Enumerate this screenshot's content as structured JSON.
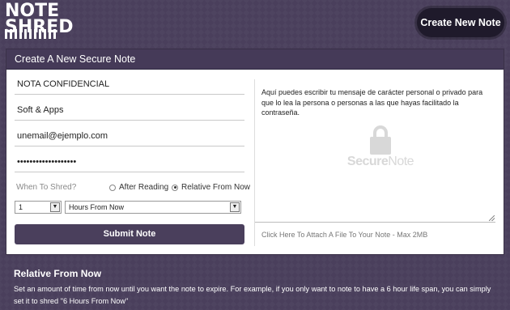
{
  "header": {
    "logo_line1": "NOTE",
    "logo_line2": "SHRED",
    "create_button": "Create New Note"
  },
  "panel": {
    "title": "Create A New Secure Note",
    "fields": {
      "title_value": "NOTA CONFIDENCIAL",
      "name_value": "Soft & Apps",
      "email_value": "unemail@ejemplo.com",
      "password_value": "•••••••••••••••••••"
    },
    "shred": {
      "label": "When To Shred?",
      "option_after": "After Reading",
      "option_relative": "Relative From Now",
      "selected": "Relative From Now",
      "amount": "1",
      "unit": "Hours From Now"
    },
    "submit": "Submit Note",
    "note_text": "Aquí puedes escribir tu mensaje de carácter personal o privado para que lo lea la persona o personas a las que hayas facilitado la contraseña.",
    "watermark_bold": "Secure",
    "watermark_rest": "Note",
    "attach_link": "Click Here To Attach A File To Your Note - Max 2MB"
  },
  "help": {
    "title": "Relative From Now",
    "text": "Set an amount of time from now until you want the note to expire. For example, if you only want to note to have a 6 hour life span, you can simply set it to shred \"6 Hours From Now\""
  },
  "colors": {
    "background": "#4a3f5c",
    "panel_header": "#453a58",
    "button_dark": "#1f1a2b"
  }
}
